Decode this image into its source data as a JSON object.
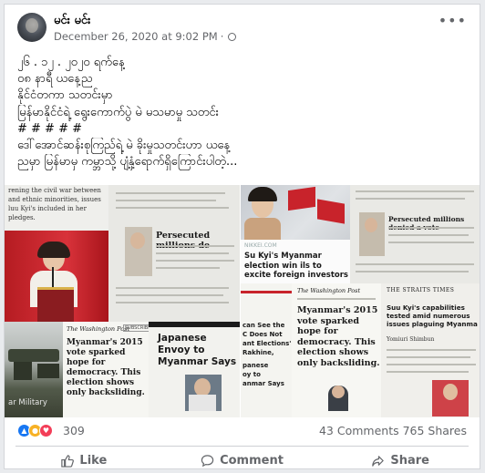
{
  "post": {
    "author": "မင်း မင်း",
    "timestamp": "December 26, 2020 at 9:02 PM",
    "dot": "·",
    "more": "•••"
  },
  "body_lines": [
    "၂၆ . ၁၂ . ၂၀၂၀ ရက်နေ့",
    "၀၈ နာရီ ယနေ့ည",
    "နိုင်ငံတကာ သတင်းမှာ",
    "မြန်မာနိုင်ငံရဲ့ ရွေးကောက်ပွဲ မဲ မသမာမှု သတင်း",
    "# # # # #",
    "ဒေါ်အောင်ဆန်းစုကြည်ရဲ့ မဲ ခိုးမှုသတင်းဟာ ယနေ့",
    "ညမှာ မြန်မာမှ ကမ္ဘာသို့ ပျံ့နှံ့ရောက်ရှိကြောင်းပါတဲ့..."
  ],
  "images": {
    "tl_paper_lines": [
      "rening the civil war between",
      "and ethnic minorities, issues",
      "luu Kyi's included in her",
      "pledges."
    ],
    "tm_headline": "Persecuted millions de",
    "bl_caption": "ar Military",
    "wapo_masthead": "The Washington Post",
    "wapo_subscribe": "SUBSCRIBE",
    "wapo_headline": "Myanmar's 2015 vote sparked hope for democracy. This election shows only backsliding.",
    "japan_top": "Japanese",
    "japan_headline": "Japanese Envoy to Myanmar Says",
    "r1_site": "NIKKEI.COM",
    "r1_headline": "Su Kyi's Myanmar election win ils to excite foreign investors",
    "r2_headline": "Persecuted millions denied a vote",
    "r3_partial": [
      "can See the",
      "C Does Not",
      "ant Elections'",
      "Rakhine,",
      "panese",
      "oy to",
      "anmar Says"
    ],
    "r4_masthead": "The Washington Post",
    "r4_headline": "Myanmar's 2015 vote sparked hope for democracy. This election shows only backsliding.",
    "r5_masthead": "THE STRAITS TIMES",
    "r5_headline": "Suu Kyi's capabilities tested amid numerous issues plaguing Myanma",
    "r5_byline": "Yomiuri Shimbun"
  },
  "stats": {
    "reaction_count": "309",
    "comments_shares": "43 Comments  765 Shares"
  },
  "actions": {
    "like": "Like",
    "comment": "Comment",
    "share": "Share"
  },
  "colors": {
    "like_blue": "#1877f2",
    "haha_yellow": "#f7b125",
    "love_red": "#f33e58",
    "flag_red": "#c8232b"
  }
}
